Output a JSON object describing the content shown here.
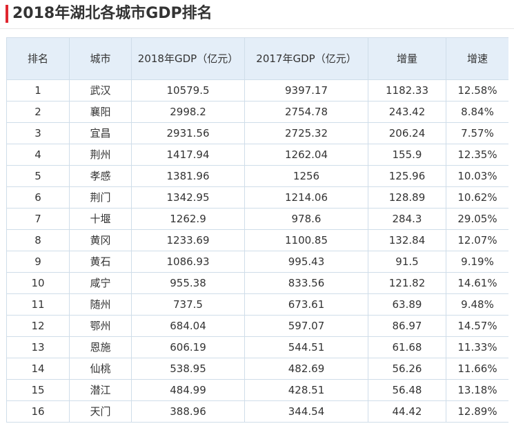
{
  "title": "2018年湖北各城市GDP排名",
  "accent_color": "#e0262f",
  "header_bg": "#e4eef8",
  "columns": [
    "排名",
    "城市",
    "2018年GDP（亿元）",
    "2017年GDP（亿元）",
    "增量",
    "增速"
  ],
  "rows": [
    [
      "1",
      "武汉",
      "10579.5",
      "9397.17",
      "1182.33",
      "12.58%"
    ],
    [
      "2",
      "襄阳",
      "2998.2",
      "2754.78",
      "243.42",
      "8.84%"
    ],
    [
      "3",
      "宜昌",
      "2931.56",
      "2725.32",
      "206.24",
      "7.57%"
    ],
    [
      "4",
      "荆州",
      "1417.94",
      "1262.04",
      "155.9",
      "12.35%"
    ],
    [
      "5",
      "孝感",
      "1381.96",
      "1256",
      "125.96",
      "10.03%"
    ],
    [
      "6",
      "荆门",
      "1342.95",
      "1214.06",
      "128.89",
      "10.62%"
    ],
    [
      "7",
      "十堰",
      "1262.9",
      "978.6",
      "284.3",
      "29.05%"
    ],
    [
      "8",
      "黄冈",
      "1233.69",
      "1100.85",
      "132.84",
      "12.07%"
    ],
    [
      "9",
      "黄石",
      "1086.93",
      "995.43",
      "91.5",
      "9.19%"
    ],
    [
      "10",
      "咸宁",
      "955.38",
      "833.56",
      "121.82",
      "14.61%"
    ],
    [
      "11",
      "随州",
      "737.5",
      "673.61",
      "63.89",
      "9.48%"
    ],
    [
      "12",
      "鄂州",
      "684.04",
      "597.07",
      "86.97",
      "14.57%"
    ],
    [
      "13",
      "恩施",
      "606.19",
      "544.51",
      "61.68",
      "11.33%"
    ],
    [
      "14",
      "仙桃",
      "538.95",
      "482.69",
      "56.26",
      "11.66%"
    ],
    [
      "15",
      "潜江",
      "484.99",
      "428.51",
      "56.48",
      "13.18%"
    ],
    [
      "16",
      "天门",
      "388.96",
      "344.54",
      "44.42",
      "12.89%"
    ]
  ]
}
